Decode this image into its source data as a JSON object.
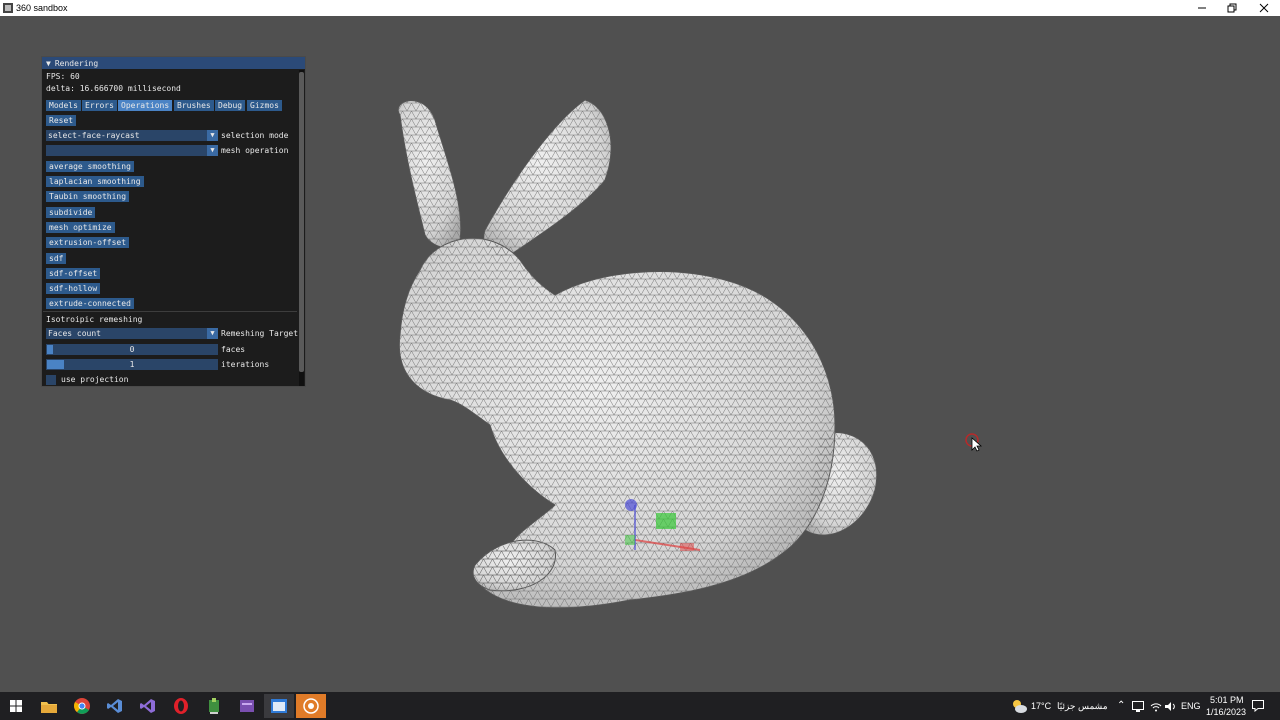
{
  "window": {
    "title": "360 sandbox"
  },
  "panel": {
    "header": "Rendering",
    "fps_line": "FPS: 60",
    "delta_line": "delta: 16.666700 millisecond",
    "tabs": [
      "Models",
      "Errors",
      "Operations",
      "Brushes",
      "Debug",
      "Gizmos"
    ],
    "active_tab": "Operations",
    "reset_label": "Reset",
    "selection_mode": {
      "value": "select-face-raycast",
      "label": "selection mode"
    },
    "mesh_operation": {
      "value": "",
      "label": "mesh operation"
    },
    "operations": [
      "average smoothing",
      "laplacian smoothing",
      "Taubin smoothing",
      "subdivide",
      "mesh optimize",
      "extrusion-offset",
      "sdf",
      "sdf-offset",
      "sdf-hollow",
      "extrude-connected"
    ],
    "remeshing_header": "Isotroipic remeshing",
    "remeshing_target": {
      "value": "Faces count",
      "label": "Remeshing Target"
    },
    "faces_slider": {
      "value": "0",
      "label": "faces",
      "fraction": 0.02
    },
    "iterations_slider": {
      "value": "1",
      "label": "iterations",
      "fraction": 0.1
    },
    "use_projection_label": "use projection",
    "use_projection_checked": false
  },
  "taskbar": {
    "apps": [
      "windows-start",
      "file-explorer",
      "chrome",
      "visual-studio-code",
      "visual-studio",
      "opera",
      "app-green",
      "app-purple",
      "app-blue-window",
      "360-sandbox"
    ],
    "weather": {
      "temp": "17°C",
      "desc": "مشمس جزئيًا"
    },
    "language": "ENG",
    "time": "5:01 PM",
    "date": "1/16/2023"
  },
  "colors": {
    "viewport": "#505050",
    "panel_header": "#2b4a78",
    "button": "#2d5a8c",
    "button_active": "#4a83c5",
    "taskbar": "#1f1f22"
  }
}
